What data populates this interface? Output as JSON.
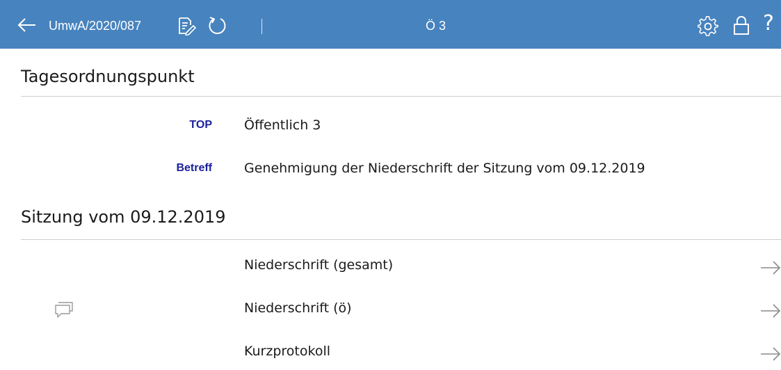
{
  "header": {
    "document_id": "UmwA/2020/087",
    "title": "Ö 3",
    "icons": [
      "back-arrow-icon",
      "edit-document-icon",
      "refresh-icon",
      "settings-icon",
      "lock-icon",
      "help-icon"
    ],
    "help_glyph": "?",
    "background_color": "#4783be"
  },
  "agenda_item": {
    "heading": "Tagesordnungspunkt",
    "fields": [
      {
        "label": "TOP",
        "value": "Öffentlich 3"
      },
      {
        "label": "Betreff",
        "value": "Genehmigung der Niederschrift der Sitzung vom 09.12.2019"
      }
    ],
    "label_color": "#1a1f9b"
  },
  "session": {
    "heading": "Sitzung vom 09.12.2019",
    "documents": [
      {
        "label": "Niederschrift (gesamt)",
        "has_comment_icon": false
      },
      {
        "label": "Niederschrift (ö)",
        "has_comment_icon": true
      },
      {
        "label": "Kurzprotokoll",
        "has_comment_icon": false
      }
    ]
  }
}
